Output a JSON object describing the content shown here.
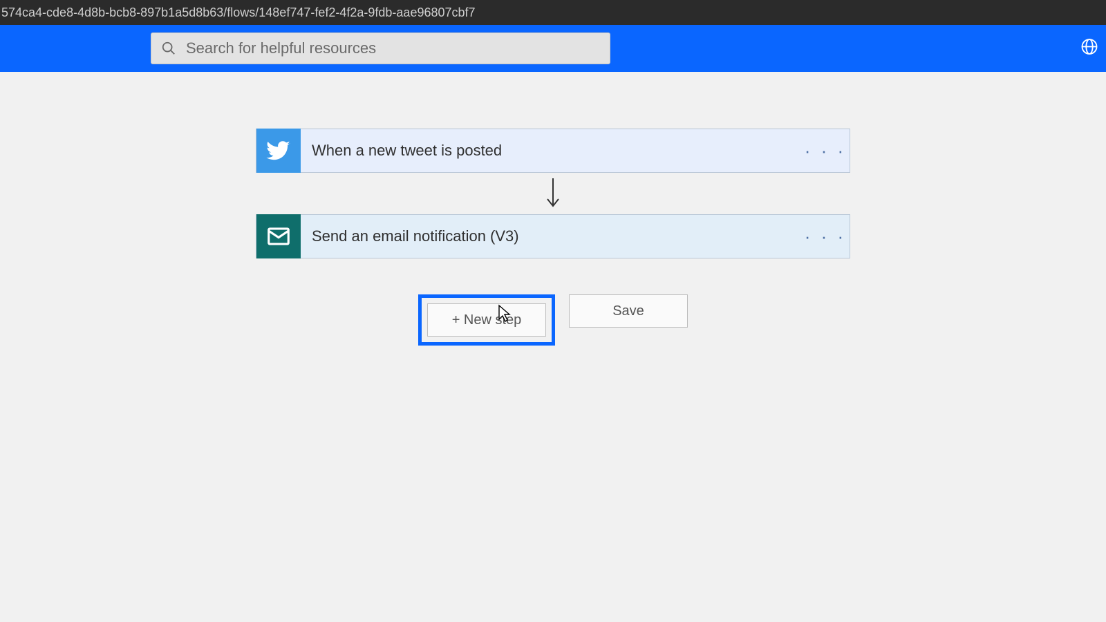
{
  "address_bar": "574ca4-cde8-4d8b-bcb8-897b1a5d8b63/flows/148ef747-fef2-4f2a-9fdb-aae96807cbf7",
  "search": {
    "placeholder": "Search for helpful resources"
  },
  "flow": {
    "trigger": {
      "title": "When a new tweet is posted"
    },
    "action": {
      "title": "Send an email notification (V3)"
    }
  },
  "buttons": {
    "new_step": "+ New step",
    "save": "Save"
  },
  "menu_glyph": "· · ·"
}
